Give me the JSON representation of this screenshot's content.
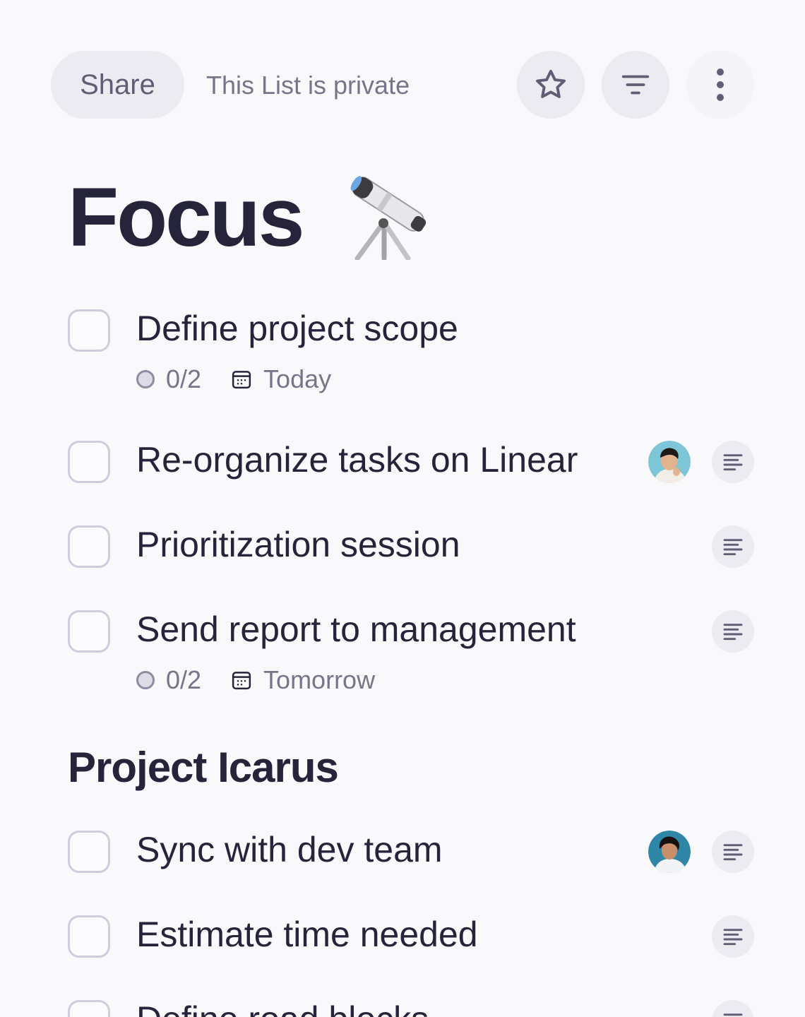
{
  "header": {
    "share_label": "Share",
    "privacy_text": "This List is private",
    "actions": [
      "star-icon",
      "filter-icon",
      "more-vertical-icon"
    ]
  },
  "list": {
    "title": "Focus",
    "title_emoji": "telescope"
  },
  "tasks": [
    {
      "label": "Define project scope",
      "subtasks": "0/2",
      "due": "Today"
    },
    {
      "label": "Re-organize tasks on Linear",
      "assignee": "avatar",
      "has_notes": true
    },
    {
      "label": "Prioritization session",
      "has_notes": true
    },
    {
      "label": "Send report to management",
      "subtasks": "0/2",
      "due": "Tomorrow",
      "has_notes": true
    }
  ],
  "section": {
    "title": "Project Icarus",
    "tasks": [
      {
        "label": "Sync with dev team",
        "assignee": "avatar",
        "has_notes": true
      },
      {
        "label": "Estimate time needed",
        "has_notes": true
      },
      {
        "label": "Define road blocks",
        "has_notes": true
      }
    ]
  },
  "colors": {
    "background": "#f9f9fc",
    "text": "#26243a",
    "muted": "#76758a",
    "button_bg": "#ebebf1",
    "checkbox_border": "#cfcddd"
  }
}
